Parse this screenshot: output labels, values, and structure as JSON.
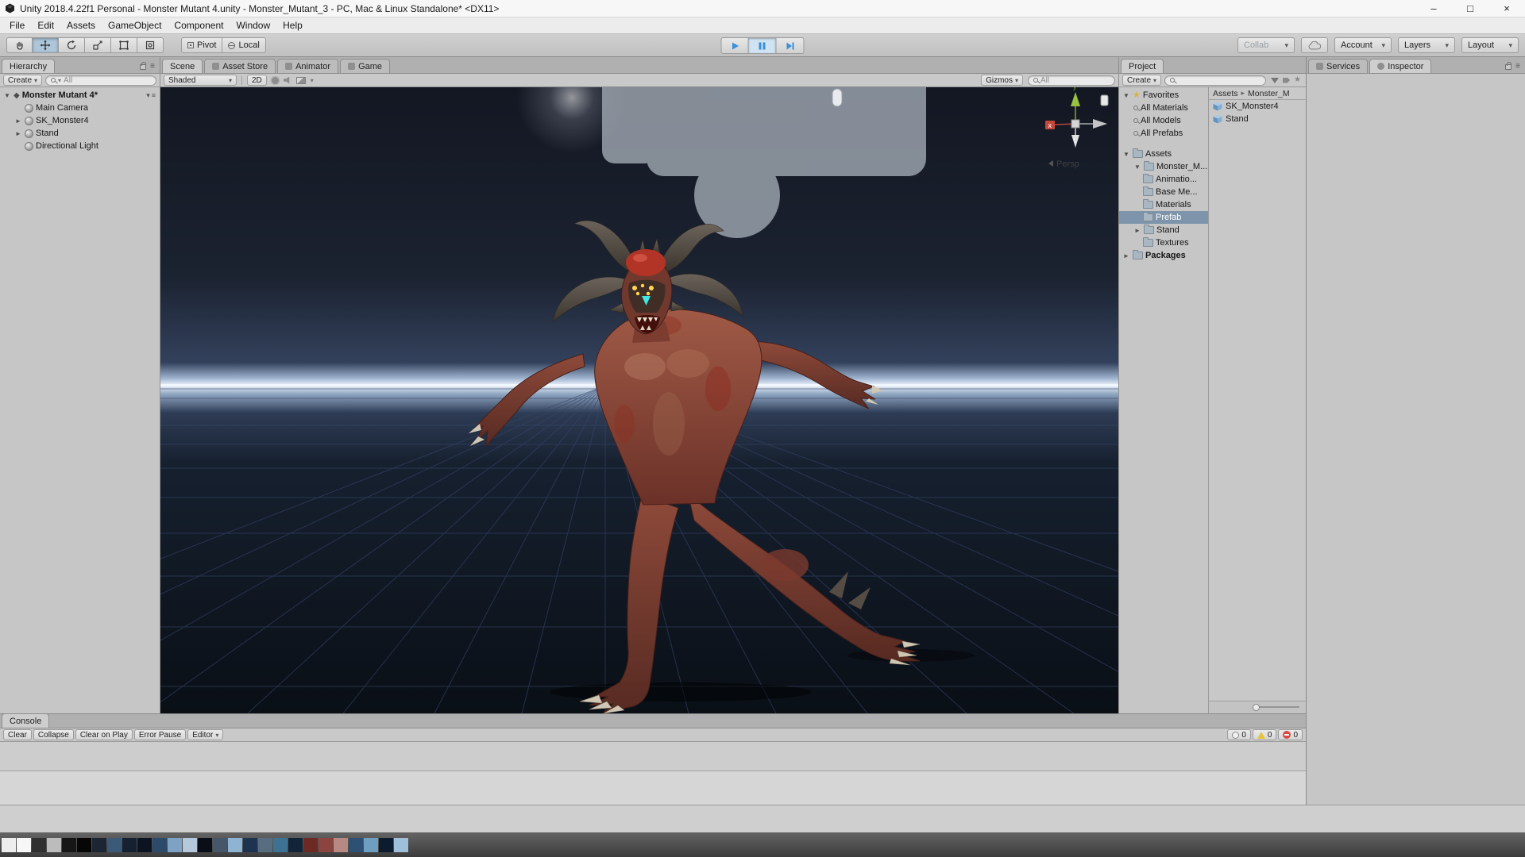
{
  "window": {
    "title": "Unity 2018.4.22f1 Personal - Monster Mutant 4.unity - Monster_Mutant_3 - PC, Mac & Linux Standalone* <DX11>"
  },
  "icons": {
    "minimize": "–",
    "maximize": "□",
    "close": "×",
    "caret": "▾",
    "expanded": "▼",
    "collapsed": "►",
    "star": "★",
    "menu": "≡",
    "breadcrumb_sep": "▸",
    "scene_glyph": "◆",
    "sun": "☀"
  },
  "menu": {
    "items": [
      "File",
      "Edit",
      "Assets",
      "GameObject",
      "Component",
      "Window",
      "Help"
    ]
  },
  "toolbar": {
    "pivot": "Pivot",
    "local": "Local",
    "collab": "Collab",
    "account": "Account",
    "layers": "Layers",
    "layout": "Layout"
  },
  "hierarchy": {
    "tab": "Hierarchy",
    "create": "Create",
    "search_text": "All",
    "scene_name": "Monster Mutant 4*",
    "items": [
      {
        "label": "Main Camera"
      },
      {
        "label": "SK_Monster4"
      },
      {
        "label": "Stand"
      },
      {
        "label": "Directional Light"
      }
    ]
  },
  "scene_view": {
    "tabs": [
      "Scene",
      "Asset Store",
      "Animator",
      "Game"
    ],
    "shading": "Shaded",
    "mode_2d": "2D",
    "gizmos": "Gizmos",
    "search_text": "All",
    "persp": "Persp",
    "axis_y": "y",
    "axis_x": "x"
  },
  "project": {
    "tab": "Project",
    "create": "Create",
    "search_text": "",
    "favorites_label": "Favorites",
    "favorites": [
      "All Materials",
      "All Models",
      "All Prefabs"
    ],
    "assets_label": "Assets",
    "folders": [
      "Monster_M...",
      "Animatio...",
      "Base Me...",
      "Materials",
      "Prefab",
      "Stand",
      "Textures"
    ],
    "packages_label": "Packages",
    "breadcrumb": {
      "root": "Assets",
      "current": "Monster_M"
    },
    "files": [
      "SK_Monster4",
      "Stand"
    ]
  },
  "inspector": {
    "tabs": [
      "Services",
      "Inspector"
    ]
  },
  "console": {
    "tab": "Console",
    "clear": "Clear",
    "collapse": "Collapse",
    "clear_on_play": "Clear on Play",
    "error_pause": "Error Pause",
    "editor": "Editor",
    "info_count": "0",
    "warning_count": "0",
    "error_count": "0"
  },
  "colors": {
    "selection": "#7d94ab",
    "play_icon": "#3d8fd6",
    "horizon": "#eef3fa",
    "monster_skin": "#8a4438",
    "horns": "#554d44"
  },
  "taskbar": {
    "swatches": [
      "#ededed",
      "#f7f7f7",
      "#303030",
      "#bcbcbc",
      "#161616",
      "#060606",
      "#1c2532",
      "#3b5a77",
      "#152030",
      "#0b1420",
      "#2c4a6a",
      "#7ea2c4",
      "#b6c8dc",
      "#0a0f17",
      "#455769",
      "#8eb3d3",
      "#1e3350",
      "#596d81",
      "#3e7293",
      "#132439",
      "#6d2a25",
      "#8b443f",
      "#b88983",
      "#2d5173",
      "#6e9fc0",
      "#0d1b2f",
      "#9ec0d9"
    ]
  }
}
